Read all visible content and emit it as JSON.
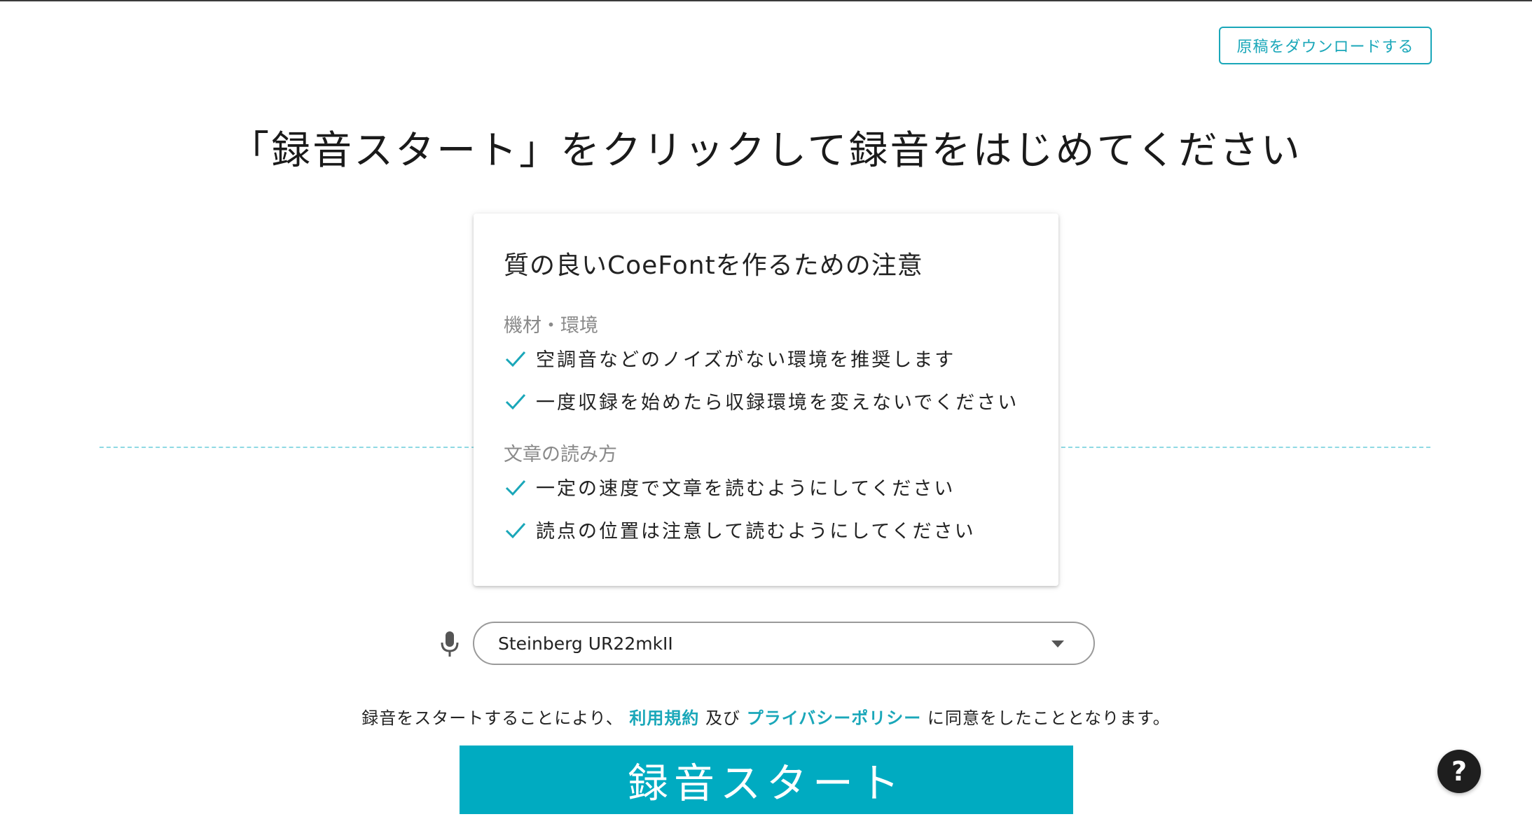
{
  "header": {
    "download_button_label": "原稿をダウンロードする"
  },
  "main": {
    "heading": "「録音スタート」をクリックして録音をはじめてください"
  },
  "notice_card": {
    "title": "質の良いCoeFontを作るための注意",
    "sections": [
      {
        "label": "機材・環境",
        "items": [
          "空調音などのノイズがない環境を推奨します",
          "一度収録を始めたら収録環境を変えないでください"
        ]
      },
      {
        "label": "文章の読み方",
        "items": [
          "一定の速度で文章を読むようにしてください",
          "読点の位置は注意して読むようにしてください"
        ]
      }
    ]
  },
  "device": {
    "selected": "Steinberg UR22mkII",
    "icon": "microphone-icon"
  },
  "consent": {
    "prefix": "録音をスタートすることにより、",
    "terms_link": "利用規約",
    "conjunction": "及び",
    "privacy_link": "プライバシーポリシー",
    "suffix": "に同意をしたこととなります。"
  },
  "record_button_label": "録音スタート",
  "help_button_label": "?",
  "colors": {
    "accent": "#00abc1",
    "link": "#1aa7b9",
    "dashed_line": "#8fd9e3"
  }
}
